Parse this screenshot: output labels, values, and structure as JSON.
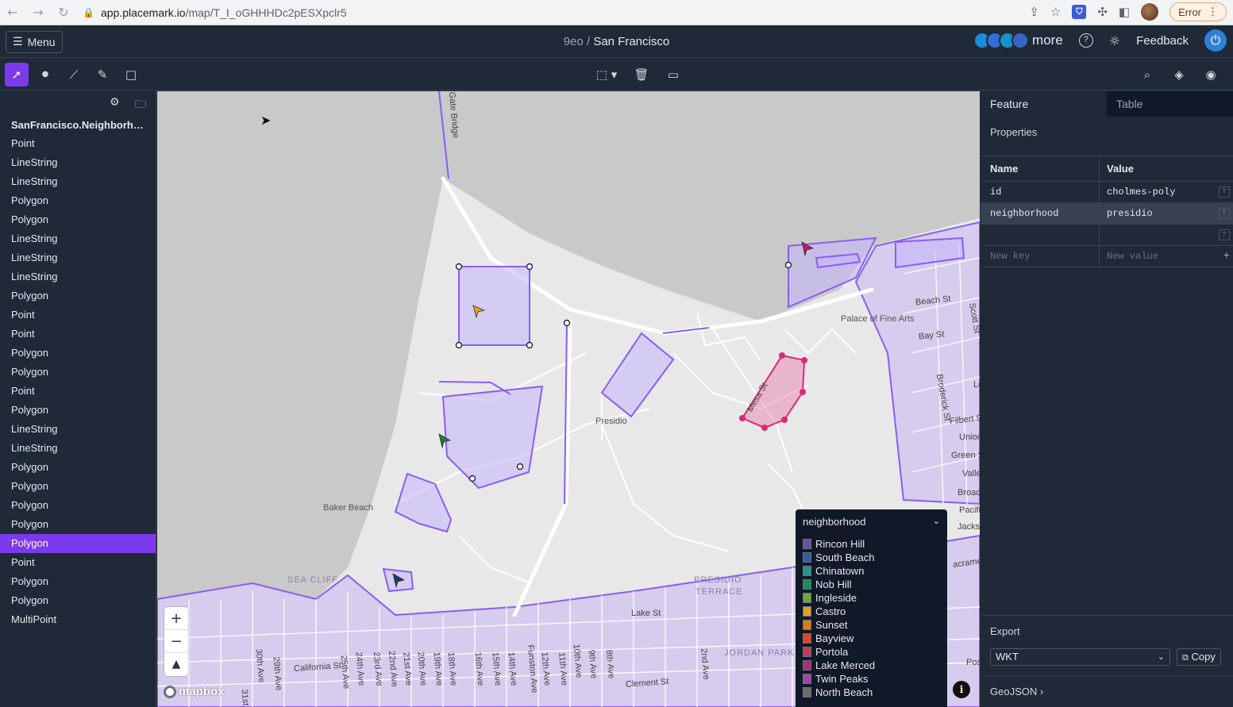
{
  "browser": {
    "url_host": "app.placemark.io",
    "url_path": "/map/T_I_oGHHHDc2pESXpclr5",
    "error_label": "Error"
  },
  "appbar": {
    "menu_label": "Menu",
    "org": "9eo",
    "separator": " / ",
    "map_name": "San Francisco",
    "more_label": "more",
    "feedback_label": "Feedback"
  },
  "sidebar": {
    "layer_title": "SanFrancisco.Neighborhood...",
    "features": [
      "Point",
      "LineString",
      "LineString",
      "Polygon",
      "Polygon",
      "LineString",
      "LineString",
      "LineString",
      "Polygon",
      "Point",
      "Point",
      "Polygon",
      "Polygon",
      "Point",
      "Polygon",
      "LineString",
      "LineString",
      "Polygon",
      "Polygon",
      "Polygon",
      "Polygon",
      "Polygon",
      "Point",
      "Polygon",
      "Polygon",
      "MultiPoint"
    ],
    "selected_index": 21
  },
  "map": {
    "labels": [
      "Palace of Fine Arts",
      "Presidio",
      "Baker Beach",
      "SEA CLIFF",
      "PRESIDIO",
      "TERRACE",
      "JORDAN PARK",
      "Lake St",
      "California St",
      "Clement St",
      "Beach St",
      "Bay St",
      "Broderick St",
      "Filbert St",
      "Union",
      "Green St",
      "Vallejo",
      "Pacific Av",
      "Jackson",
      "Mesa St",
      "Gate Bridge",
      "30th Ave",
      "29th Ave",
      "25th Ave",
      "24th Ave",
      "23rd Ave",
      "22nd Ave",
      "21st Ave",
      "20th Ave",
      "19th Ave",
      "18th Ave",
      "16th Ave",
      "15th Ave",
      "14th Ave",
      "Funston Ave",
      "12th Ave",
      "11th Ave",
      "10th Ave",
      "9th Ave",
      "8th Ave",
      "2nd Ave",
      "Scott St",
      "Lo",
      "Broad",
      "Pos",
      "acrament",
      "31st"
    ],
    "attribution": "mapbox"
  },
  "legend": {
    "title": "neighborhood",
    "items": [
      {
        "label": "Rincon Hill",
        "color": "#6b4fa0"
      },
      {
        "label": "South Beach",
        "color": "#2f5f9e"
      },
      {
        "label": "Chinatown",
        "color": "#2a8f8f"
      },
      {
        "label": "Nob Hill",
        "color": "#1f8a5a"
      },
      {
        "label": "Ingleside",
        "color": "#6fa83a"
      },
      {
        "label": "Castro",
        "color": "#e0a21a"
      },
      {
        "label": "Sunset",
        "color": "#e07b1a"
      },
      {
        "label": "Bayview",
        "color": "#d9472b"
      },
      {
        "label": "Portola",
        "color": "#c23a5c"
      },
      {
        "label": "Lake Merced",
        "color": "#a0317a"
      },
      {
        "label": "Twin Peaks",
        "color": "#9a4aa3"
      },
      {
        "label": "North Beach",
        "color": "#6b6b6b"
      }
    ]
  },
  "panel": {
    "tab_feature": "Feature",
    "tab_table": "Table",
    "properties_title": "Properties",
    "col_name": "Name",
    "col_value": "Value",
    "rows": [
      {
        "key": "id",
        "value": "cholmes-poly"
      },
      {
        "key": "neighborhood",
        "value": "presidio"
      }
    ],
    "new_key_placeholder": "New key",
    "new_value_placeholder": "New value",
    "export_label": "Export",
    "export_format": "WKT",
    "copy_label": "Copy",
    "geojson_label": "GeoJSON ›"
  }
}
